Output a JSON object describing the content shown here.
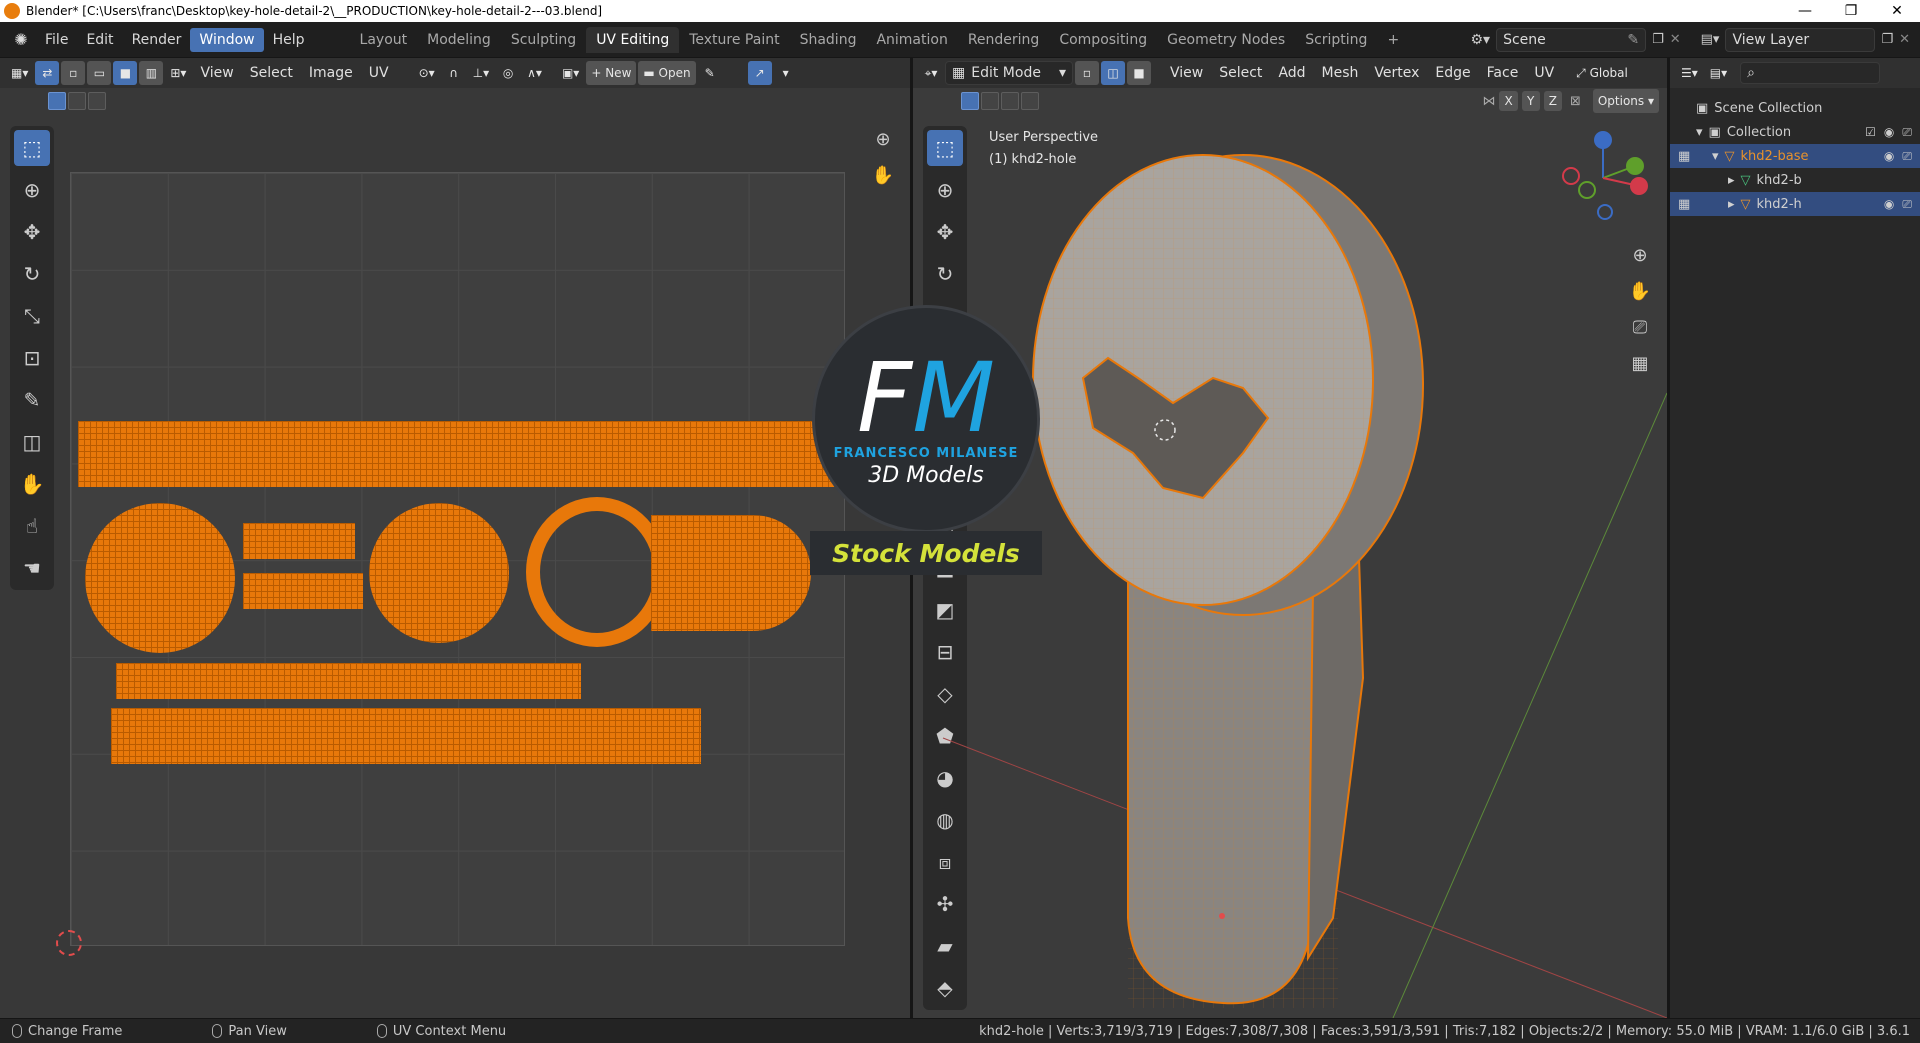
{
  "window": {
    "title": "Blender* [C:\\Users\\franc\\Desktop\\key-hole-detail-2\\__PRODUCTION\\key-hole-detail-2---03.blend]",
    "controls": [
      "—",
      "❐",
      "✕"
    ]
  },
  "topbar": {
    "menus": [
      "File",
      "Edit",
      "Render",
      "Window",
      "Help"
    ],
    "active_menu": "Window",
    "workspaces": [
      "Layout",
      "Modeling",
      "Sculpting",
      "UV Editing",
      "Texture Paint",
      "Shading",
      "Animation",
      "Rendering",
      "Compositing",
      "Geometry Nodes",
      "Scripting"
    ],
    "active_workspace": "UV Editing",
    "add_workspace": "+",
    "scene": "Scene",
    "view_layer": "View Layer"
  },
  "uv_editor": {
    "menus": [
      "View",
      "Select",
      "Image",
      "UV"
    ],
    "new_label": "New",
    "open_label": "Open"
  },
  "viewport": {
    "mode": "Edit Mode",
    "menus": [
      "View",
      "Select",
      "Add",
      "Mesh",
      "Vertex",
      "Edge",
      "Face",
      "UV"
    ],
    "orientation": "Global",
    "axes": [
      "X",
      "Y",
      "Z"
    ],
    "options_label": "Options",
    "perspective": "User Perspective",
    "object_info": "(1) khd2-hole"
  },
  "outliner": {
    "scene_collection": "Scene Collection",
    "collection": "Collection",
    "items": [
      {
        "label": "khd2-base",
        "color": "#e8922b"
      },
      {
        "label": "khd2-b",
        "color": "#d0d0d0"
      },
      {
        "label": "khd2-h",
        "color": "#d0d0d0"
      }
    ]
  },
  "statusbar": {
    "hints": [
      "Change Frame",
      "Pan View",
      "UV Context Menu"
    ],
    "stats": "khd2-hole | Verts:3,719/3,719 | Edges:7,308/7,308 | Faces:3,591/3,591 | Tris:7,182 | Objects:2/2 | Memory: 55.0 MiB | VRAM: 1.1/6.0 GiB | 3.6.1"
  },
  "watermark": {
    "logo_f": "F",
    "logo_m": "M",
    "name": "FRANCESCO MILANESE",
    "subtitle": "3D Models",
    "band": "Stock Models"
  },
  "colors": {
    "accent": "#4772b3",
    "mesh_orange": "#e8780a",
    "watermark_blue": "#1fa3e0",
    "watermark_yellow": "#d4e23a"
  }
}
